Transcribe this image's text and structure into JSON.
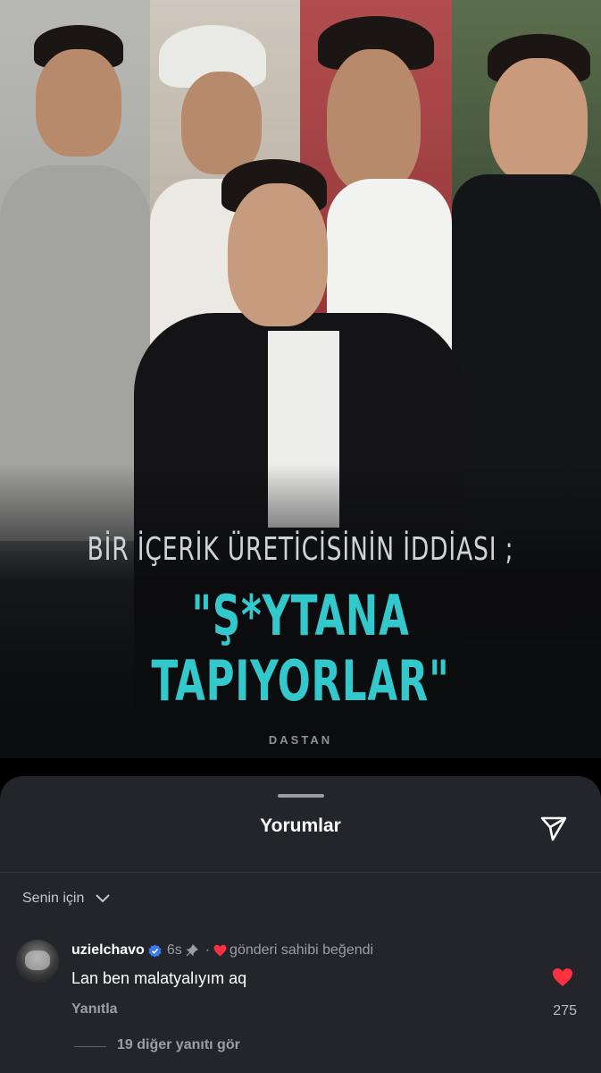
{
  "post": {
    "headline_line1": "BİR İÇERİK ÜRETİCİSİNİN İDDİASI ;",
    "headline_line2": "\"Ş*YTANA TAPIYORLAR\"",
    "brand": "DASTAN",
    "carousel_count": 2,
    "carousel_active_index": 0
  },
  "comments_sheet": {
    "title": "Yorumlar",
    "filter_label": "Senin için",
    "comment": {
      "username": "uzielchavo",
      "time": "6s",
      "separator": "·",
      "liked_by_author": "gönderi sahibi beğendi",
      "text": "Lan ben malatyalıyım aq",
      "reply_label": "Yanıtla",
      "like_count": "275"
    },
    "more_replies": "19 diğer yanıtı gör"
  },
  "colors": {
    "headline_accent": "#33c8cc",
    "heart": "#ff3040",
    "verified": "#3d79f2",
    "sheet_bg": "#23252b"
  },
  "icons": [
    "send-icon",
    "chevron-down-icon",
    "verified-badge-icon",
    "pin-icon",
    "heart-icon"
  ]
}
